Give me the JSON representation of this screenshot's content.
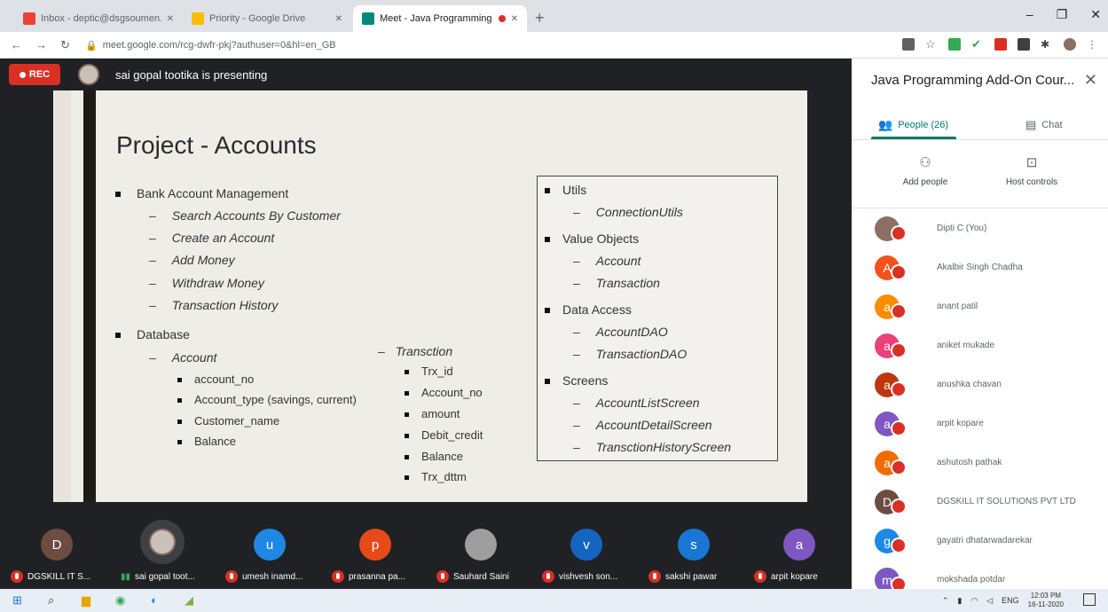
{
  "browser": {
    "tabs": [
      {
        "label": "Inbox - deptic@dsgsoumen.edu.in",
        "fav_color": "#ea4335"
      },
      {
        "label": "Priority - Google Drive",
        "fav_color": "#fbbc04"
      },
      {
        "label": "Meet - Java Programming A",
        "fav_color": "#00897b"
      }
    ],
    "url": "meet.google.com/rcg-dwfr-pkj?authuser=0&hl=en_GB",
    "extensions": [
      "#5f6368",
      "#5f6368",
      "#34a853",
      "#34a853",
      "#d93025",
      "#3c4043",
      "#3c4043",
      "#8d6e63"
    ]
  },
  "meet": {
    "rec_label": "REC",
    "presenting": "sai gopal tootika is presenting"
  },
  "slide": {
    "title": "Project - Accounts",
    "bank": "Bank Account Management",
    "bank_items": [
      "Search Accounts By Customer",
      "Create an Account",
      "Add Money",
      "Withdraw Money",
      "Transaction History"
    ],
    "database": "Database",
    "account": "Account",
    "account_fields": [
      "account_no",
      "Account_type (savings, current)",
      "Customer_name",
      "Balance"
    ],
    "transaction": "Transction",
    "transaction_fields": [
      "Trx_id",
      "Account_no",
      "amount",
      "Debit_credit",
      "Balance",
      "Trx_dttm"
    ],
    "utils": "Utils",
    "utils_items": [
      "ConnectionUtils"
    ],
    "value_objects": "Value Objects",
    "value_items": [
      "Account",
      "Transaction"
    ],
    "data_access": "Data Access",
    "data_items": [
      "AccountDAO",
      "TransactionDAO"
    ],
    "screens": "Screens",
    "screen_items": [
      "AccountListScreen",
      "AccountDetailScreen",
      "TransctionHistoryScreen"
    ]
  },
  "tiles": [
    {
      "initial": "D",
      "color": "#6d4c41",
      "label": "DGSKILL IT S..."
    },
    {
      "initial": "",
      "color": "#3c4043",
      "label": "sai gopal toot..."
    },
    {
      "initial": "u",
      "color": "#1e88e5",
      "label": "umesh inamd..."
    },
    {
      "initial": "p",
      "color": "#e64a19",
      "label": "prasanna pa..."
    },
    {
      "initial": "",
      "color": "#9e9e9e",
      "label": "Sauhard Saini"
    },
    {
      "initial": "v",
      "color": "#1565c0",
      "label": "vishvesh son..."
    },
    {
      "initial": "s",
      "color": "#1976d2",
      "label": "sakshi pawar"
    },
    {
      "initial": "a",
      "color": "#7e57c2",
      "label": "arpit kopare"
    }
  ],
  "panel": {
    "title": "Java Programming Add-On Cour...",
    "people_tab": "People (26)",
    "chat_tab": "Chat",
    "add_people": "Add people",
    "host_controls": "Host controls",
    "people": [
      {
        "initial": "",
        "color": "#8d6e63",
        "name": "Dipti C (You)"
      },
      {
        "initial": "A",
        "color": "#f4511e",
        "name": "Akalbir Singh Chadha"
      },
      {
        "initial": "a",
        "color": "#fb8c00",
        "name": "anant patil"
      },
      {
        "initial": "a",
        "color": "#ec407a",
        "name": "aniket mukade"
      },
      {
        "initial": "a",
        "color": "#bf360c",
        "name": "anushka chavan"
      },
      {
        "initial": "a",
        "color": "#7e57c2",
        "name": "arpit kopare"
      },
      {
        "initial": "a",
        "color": "#ef6c00",
        "name": "ashutosh pathak"
      },
      {
        "initial": "D",
        "color": "#6d4c41",
        "name": "DGSKILL IT SOLUTIONS PVT LTD"
      },
      {
        "initial": "g",
        "color": "#1e88e5",
        "name": "gayatri dhatarwadarekar"
      },
      {
        "initial": "m",
        "color": "#7e57c2",
        "name": "mokshada potdar"
      }
    ]
  },
  "taskbar": {
    "lang": "ENG",
    "time": "12:03 PM",
    "date": "16-11-2020"
  }
}
